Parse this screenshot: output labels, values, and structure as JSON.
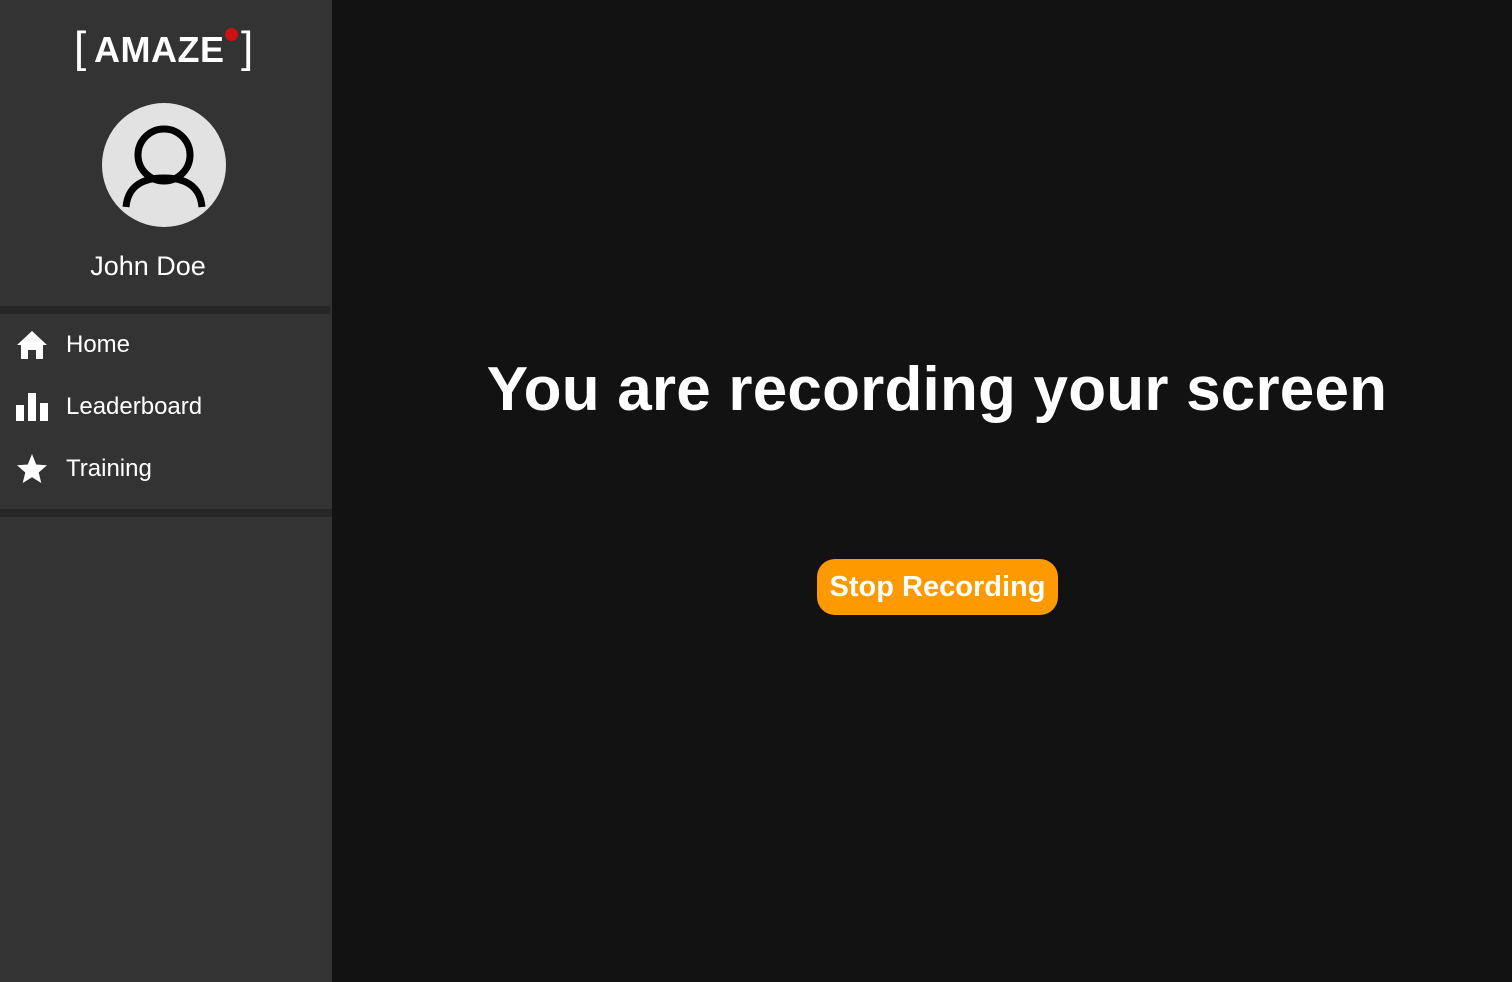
{
  "brand": {
    "left_bracket": "[",
    "name": "AMAZE",
    "right_bracket": "]",
    "dot_color": "#cc1111"
  },
  "user": {
    "name": "John Doe",
    "avatar_icon": "user-outline-icon"
  },
  "sidebar": {
    "items": [
      {
        "label": "Home",
        "icon": "home-icon"
      },
      {
        "label": "Leaderboard",
        "icon": "bar-chart-icon"
      },
      {
        "label": "Training",
        "icon": "star-icon"
      }
    ]
  },
  "main": {
    "headline": "You are recording your screen",
    "stop_label": "Stop Recording"
  },
  "colors": {
    "sidebar_bg": "#333333",
    "main_bg": "#121212",
    "accent": "#ff9900"
  }
}
